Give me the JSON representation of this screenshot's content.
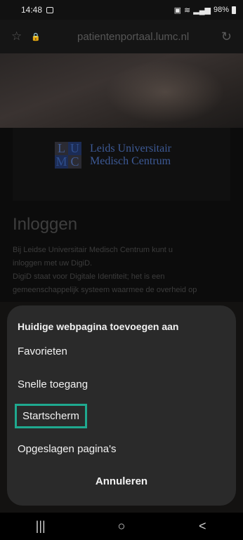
{
  "status_bar": {
    "time": "14:48",
    "right_text": "98%",
    "icons": [
      "photo-icon",
      "sim-icon",
      "wifi-icon",
      "signal-icon",
      "battery-icon"
    ]
  },
  "browser": {
    "url": "patientenportaal.lumc.nl",
    "icons": {
      "star": "☆",
      "lock": "🔒",
      "reload": "↻"
    }
  },
  "page": {
    "logo": {
      "letters": [
        "L",
        "U",
        "M",
        "C"
      ],
      "line1": "Leids Universitair",
      "line2": "Medisch Centrum"
    },
    "title": "Inloggen",
    "intro": [
      "Bij Leidse Universitair Medisch Centrum kunt u",
      "inloggen met uw DigiD.",
      "DigiD staat voor Digitale Identiteit; het is een",
      "gemeenschappelijk systeem waarmee de overheid op"
    ]
  },
  "sheet": {
    "title": "Huidige webpagina toevoegen aan",
    "options": [
      "Favorieten",
      "Snelle toegang",
      "Startscherm",
      "Opgeslagen pagina's"
    ],
    "highlighted_option": "Startscherm",
    "cancel_label": "Annuleren",
    "highlight_color": "#1fa98f"
  },
  "nav_bar": {
    "recent": "|||",
    "home": "○",
    "back": "<"
  }
}
